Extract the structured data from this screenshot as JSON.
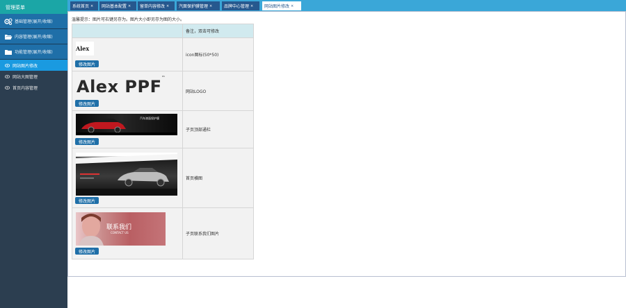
{
  "sidebar": {
    "title": "管理菜单",
    "groups": [
      {
        "label": "基础管理(展开/收缩)"
      },
      {
        "label": "内容管理(展开/收缩)"
      },
      {
        "label": "功能管理(展开/收缩)"
      }
    ],
    "items": [
      {
        "label": "网站图片修改",
        "active": true
      },
      {
        "label": "网站大图管理",
        "active": false
      },
      {
        "label": "首页内容管理",
        "active": false
      }
    ]
  },
  "tabs": [
    {
      "label": "系统首页",
      "close": "×",
      "active": false
    },
    {
      "label": "网站基本配置",
      "close": "×",
      "active": false
    },
    {
      "label": "留单内容修改",
      "close": "×",
      "active": false
    },
    {
      "label": "汽面保护膜管理",
      "close": "×",
      "active": false
    },
    {
      "label": "品牌中心管理",
      "close": "×",
      "active": false
    },
    {
      "label": "网站图片修改",
      "close": "×",
      "active": true
    }
  ],
  "content": {
    "tip": "温馨提示：图片可右键另存为。图片大小即另存为图的大小。",
    "table": {
      "header_note": "备注，双击可修改",
      "button_label": "修改图片",
      "rows": [
        {
          "note": "icon图标(50*50)",
          "image_text": "Alex"
        },
        {
          "note": "网站LOGO",
          "image_text": "Alex PPF",
          "image_mark": "™"
        },
        {
          "note": "子页顶部通栏",
          "image_text": "汽车漆面保护膜"
        },
        {
          "note": "首页横图",
          "image_text": ""
        },
        {
          "note": "子页联系我们图片",
          "image_text": "联系我们",
          "image_subtext": "CONTACT US"
        }
      ]
    }
  },
  "colors": {
    "sidebar_bg": "#2c3e50",
    "sidebar_header": "#1ba6a6",
    "group_bg": "#1f6fa8",
    "active_item": "#1a9ae0",
    "tabbar_bg": "#3aa7d8",
    "tab_bg": "#26588e",
    "button_bg": "#1f6fa8",
    "table_header_bg": "#d1eaef"
  },
  "icons": {
    "group_0": "gears-icon",
    "group_1": "folder-open-icon",
    "group_2": "folder-icon",
    "item": "eye-icon"
  }
}
